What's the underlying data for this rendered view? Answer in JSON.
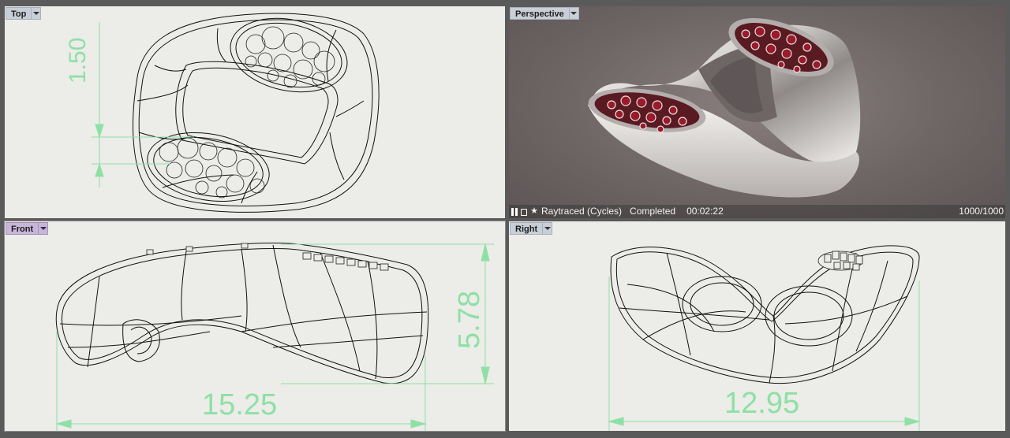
{
  "viewports": {
    "top": {
      "label": "Top",
      "dimension": "1.50"
    },
    "perspective": {
      "label": "Perspective",
      "status": {
        "icons": [
          "pause-icon",
          "lock-icon",
          "star-icon"
        ],
        "mode": "Raytraced (Cycles)",
        "state": "Completed",
        "time": "00:02:22",
        "samples": "1000/1000"
      }
    },
    "front": {
      "label": "Front",
      "dimension_width": "15.25",
      "dimension_height": "5.78"
    },
    "right": {
      "label": "Right",
      "dimension_width": "12.95"
    }
  },
  "colors": {
    "dimension": "#8ee0a6",
    "viewport_bg": "#ecece8",
    "tab_default": "#c9cfd8",
    "tab_active": "#c7b6d9",
    "gem": "#9a1a2a"
  }
}
